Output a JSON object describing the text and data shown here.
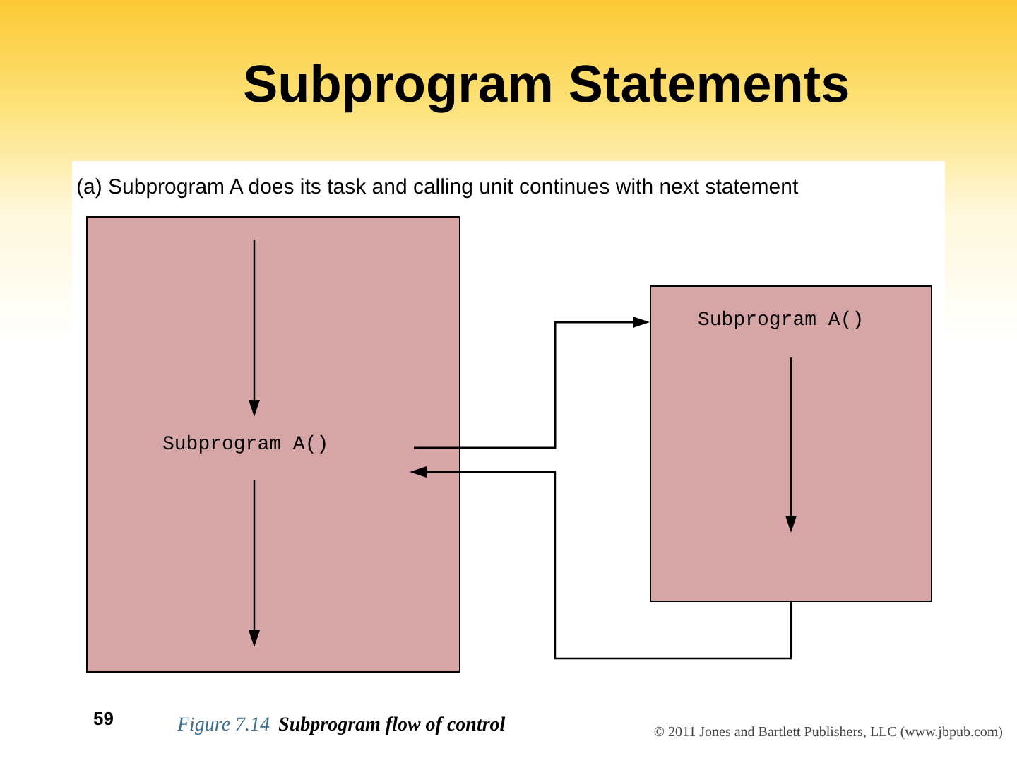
{
  "title": "Subprogram Statements",
  "figure": {
    "caption": "(a) Subprogram A does its task and calling unit continues with next statement",
    "calling_unit": {
      "label": "Subprogram A()"
    },
    "subprogram": {
      "label": "Subprogram A()"
    }
  },
  "footer": {
    "page_number": "59",
    "figure_label": "Figure 7.14",
    "figure_title": "Subprogram flow of control",
    "copyright": "© 2011 Jones and Bartlett Publishers, LLC (www.jbpub.com)"
  }
}
